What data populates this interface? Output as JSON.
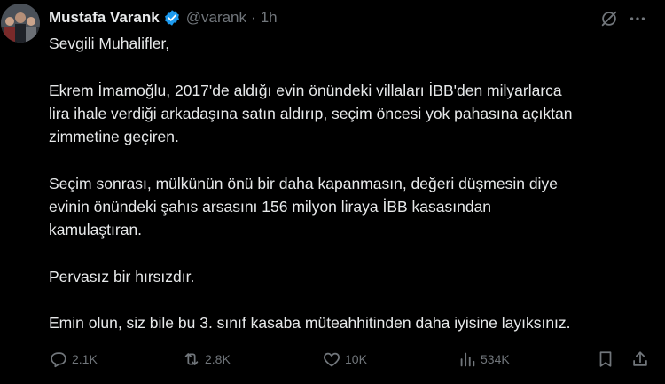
{
  "author": {
    "name": "Mustafa Varank",
    "handle": "@varank",
    "separator": "·",
    "time": "1h"
  },
  "icons": {
    "verified": "verified-badge-icon",
    "grok": "grok-icon",
    "more": "more-icon",
    "reply": "reply-icon",
    "retweet": "retweet-icon",
    "like": "like-icon",
    "views": "views-icon",
    "bookmark": "bookmark-icon",
    "share": "share-icon"
  },
  "colors": {
    "background": "#000000",
    "text": "#e7e9ea",
    "muted": "#71767b",
    "verified": "#1d9bf0"
  },
  "tweet": {
    "lines": [
      "Sevgili Muhalifler,",
      "Ekrem İmamoğlu, 2017'de aldığı evin önündeki villaları İBB'den milyarlarca",
      "lira ihale verdiği arkadaşına satın aldırıp, seçim öncesi yok pahasına açıktan",
      "zimmetine geçiren.",
      "Seçim sonrası, mülkünün önü bir daha kapanmasın, değeri düşmesin diye",
      "evinin önündeki şahıs arsasını 156 milyon liraya İBB kasasından",
      "kamulaştıran.",
      "Pervasız bir hırsızdır.",
      "Emin olun, siz bile bu 3. sınıf kasaba müteahhitinden daha iyisine layıksınız."
    ]
  },
  "stats": {
    "replies": "2.1K",
    "retweets": "2.8K",
    "likes": "10K",
    "views": "534K"
  }
}
